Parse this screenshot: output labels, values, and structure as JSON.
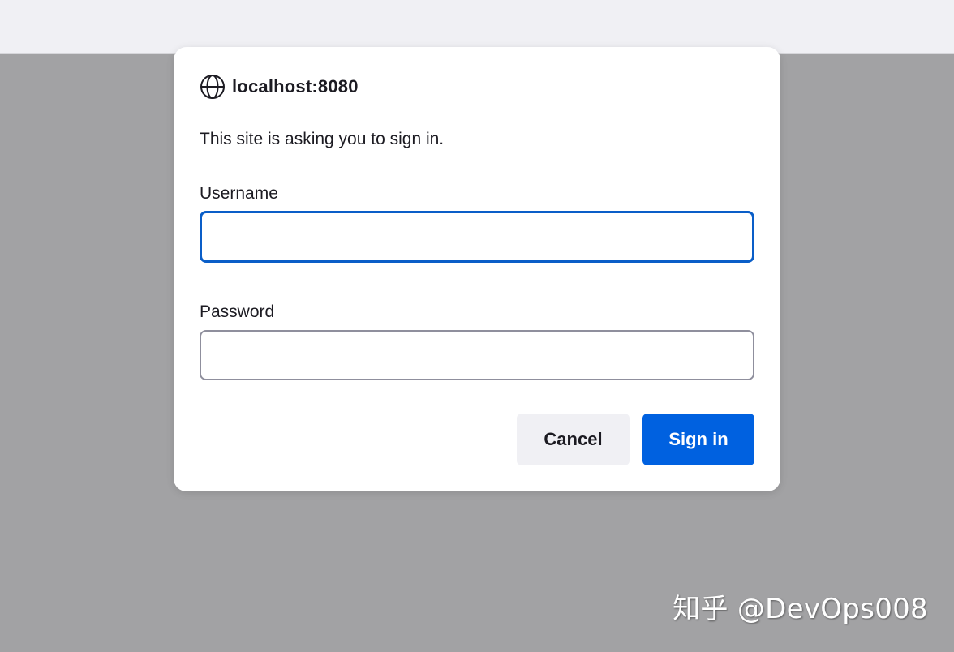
{
  "dialog": {
    "origin": "localhost:8080",
    "origin_icon": "globe-icon",
    "message": "This site is asking you to sign in.",
    "username": {
      "label": "Username",
      "value": "",
      "focused": true
    },
    "password": {
      "label": "Password",
      "value": ""
    },
    "buttons": {
      "cancel": "Cancel",
      "sign_in": "Sign in"
    }
  },
  "watermark": "知乎 @DevOps008",
  "colors": {
    "accent": "#0061e0",
    "focus_border": "#0a5ec8",
    "backdrop": "#a2a2a4",
    "dialog_bg": "#ffffff",
    "cancel_bg": "#f0f0f4"
  }
}
